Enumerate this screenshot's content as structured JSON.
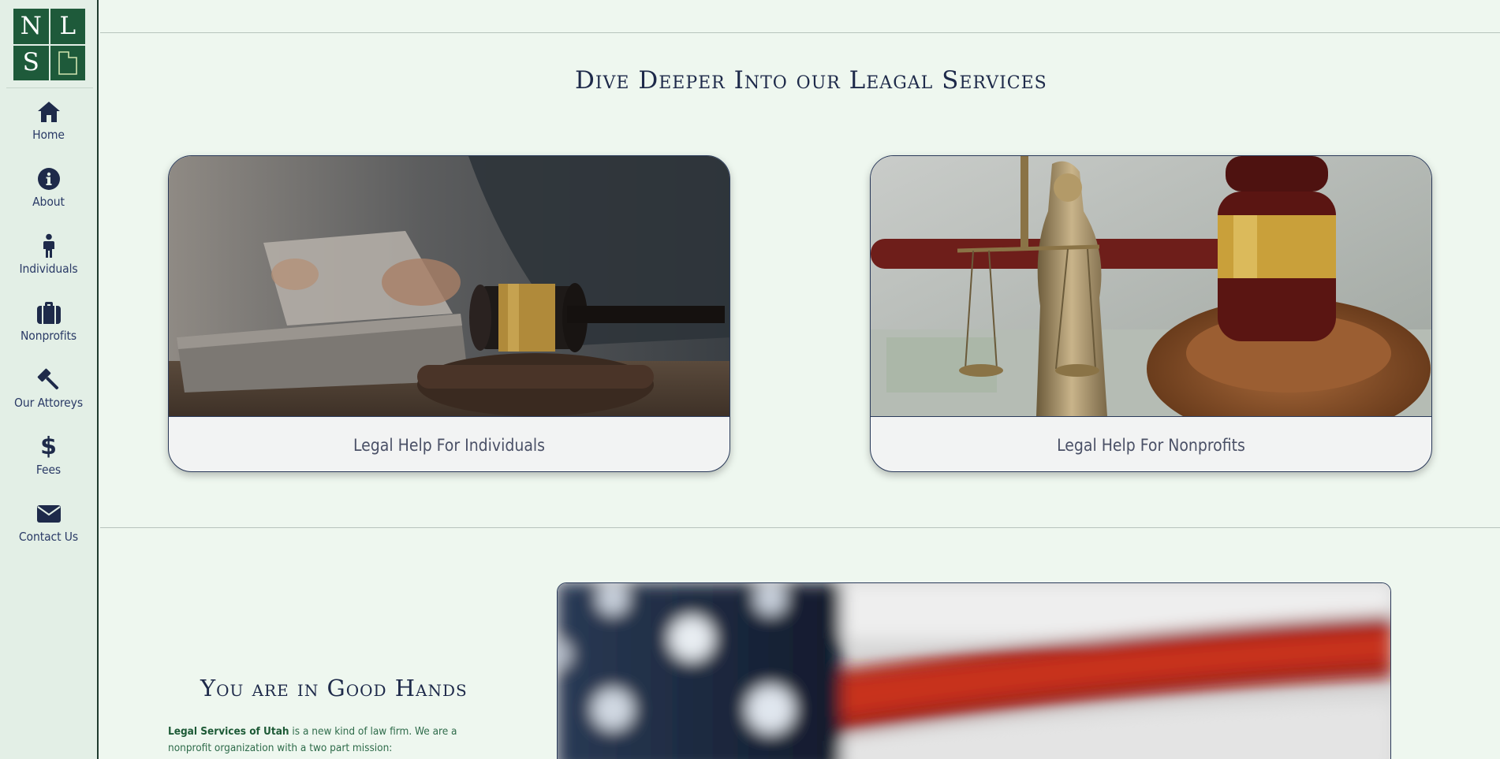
{
  "logo": {
    "letters": [
      "N",
      "L",
      "S"
    ]
  },
  "nav": [
    {
      "label": "Home",
      "icon": "home-icon"
    },
    {
      "label": "About",
      "icon": "info-icon"
    },
    {
      "label": "Individuals",
      "icon": "person-icon"
    },
    {
      "label": "Nonprofits",
      "icon": "briefcase-icon"
    },
    {
      "label": "Our Attoreys",
      "icon": "gavel-icon"
    },
    {
      "label": "Fees",
      "icon": "dollar-icon"
    },
    {
      "label": "Contact Us",
      "icon": "envelope-icon"
    }
  ],
  "services": {
    "title": "Dive Deeper Into our Leagal Services",
    "cards": [
      {
        "caption": "Legal Help For Individuals"
      },
      {
        "caption": "Legal Help For Nonprofits"
      }
    ]
  },
  "hands": {
    "title": "You are in Good Hands",
    "org": "Legal Services of Utah",
    "text": " is a new kind of law firm. We are a nonprofit organization with a two part mission:"
  },
  "colors": {
    "brand": "#1e5a3a",
    "navy": "#1e2a4a",
    "background": "#eef7ef"
  }
}
